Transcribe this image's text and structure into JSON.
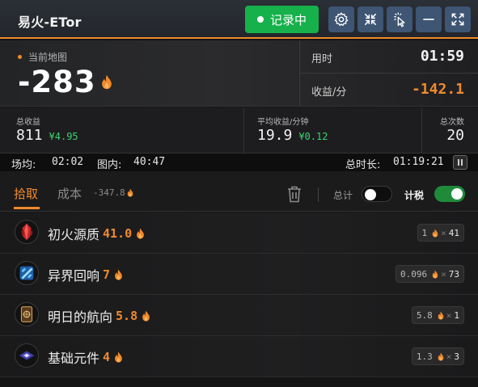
{
  "window": {
    "title": "易火-ETor"
  },
  "toolbar": {
    "record_label": "记录中",
    "icons": [
      "gear-icon",
      "collapse-icon",
      "cursor-click-icon",
      "minimize-icon",
      "expand-icon"
    ]
  },
  "map": {
    "label": "当前地图",
    "value": "-283"
  },
  "time": {
    "label": "用时",
    "value": "01:59"
  },
  "rate": {
    "label": "收益/分",
    "value": "-142.1"
  },
  "totals": {
    "income_label": "总收益",
    "income_value": "811",
    "income_sub": "¥4.95",
    "avg_label": "平均收益/分钟",
    "avg_value": "19.9",
    "avg_sub": "¥0.12",
    "count_label": "总次数",
    "count_value": "20"
  },
  "timebar": {
    "avg_field_label": "场均:",
    "avg_field_value": "02:02",
    "in_map_label": "图内:",
    "in_map_value": "40:47",
    "total_time_label": "总时长:",
    "total_time_value": "01:19:21"
  },
  "tabs": {
    "pick_label": "拾取",
    "cost_label": "成本",
    "cost_value": "-347.8",
    "total_toggle_label": "总计",
    "total_toggle_on": false,
    "tax_toggle_label": "计税",
    "tax_toggle_on": true
  },
  "items": [
    {
      "name": "初火源质",
      "price": "41.0",
      "unit": "1",
      "count": "41",
      "icon": "fire-crystal-icon"
    },
    {
      "name": "异界回响",
      "price": "7",
      "unit": "0.096",
      "count": "73",
      "icon": "blue-crystal-icon"
    },
    {
      "name": "明日的航向",
      "price": "5.8",
      "unit": "5.8",
      "count": "1",
      "icon": "card-icon"
    },
    {
      "name": "基础元件",
      "price": "4",
      "unit": "1.3",
      "count": "3",
      "icon": "gem-component-icon"
    }
  ],
  "colors": {
    "accent": "#f08a2c",
    "record_green": "#17b14b",
    "positive": "#3bd26f",
    "toolbar_button": "#3e5573"
  }
}
